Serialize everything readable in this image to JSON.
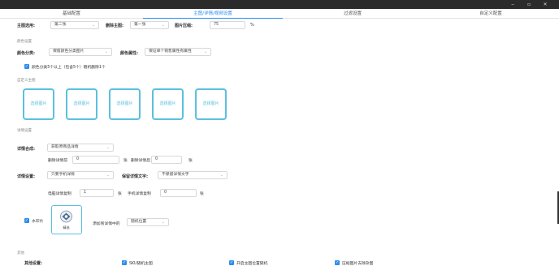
{
  "window": {
    "minimize": "‒",
    "maximize": "▫",
    "close": "✕"
  },
  "tabs": [
    {
      "label": "基础配置"
    },
    {
      "label": "主图/详情/视频设置",
      "active": true
    },
    {
      "label": "过滤设置"
    },
    {
      "label": "自定义配置"
    }
  ],
  "main_image": {
    "use_label": "主图选用:",
    "use_value": "第二张",
    "delete_label": "删除主图:",
    "delete_value": "第一张",
    "compress_label": "图片压缩:",
    "compress_value": "75",
    "compress_unit": "%"
  },
  "color_settings": {
    "section": "颜色设置",
    "class_label": "颜色分类:",
    "class_value": "保留颜色分类图片",
    "attr_label": "颜色属性:",
    "attr_value": "保证单个销售属性有属性",
    "checkbox_label": "颜色分类5个以上（包含5个）随机删除1个"
  },
  "custom_main": {
    "section": "自定义主图",
    "upload_label": "选择图片"
  },
  "detail_settings": {
    "section": "详情设置",
    "compose_label": "详情合成:",
    "compose_value": "获取原商品详情",
    "delete_front_label": "删除详情前",
    "delete_front_value": "0",
    "unit_zhang": "张",
    "delete_back_label": "删除详情后",
    "delete_back_value": "0",
    "detail_set_label": "详情设置:",
    "detail_set_value": "只要手机详情",
    "keep_text_label": "保留详情文字:",
    "keep_text_value": "不保留详情文字",
    "pc_copy_label": "电脑详情复制",
    "pc_copy_value": "1",
    "mobile_copy_label": "手机详情复制",
    "mobile_copy_value": "0",
    "watermark_checkbox": "水印片",
    "logo_text": "精选",
    "add_to_label": "添加到详情中的",
    "add_to_value": "随机位置"
  },
  "others": {
    "section": "其他",
    "other_label": "其他设置:",
    "checks": [
      "SKU随机主图",
      "开启主图位置随机",
      "压缩图片去除杂图"
    ]
  }
}
